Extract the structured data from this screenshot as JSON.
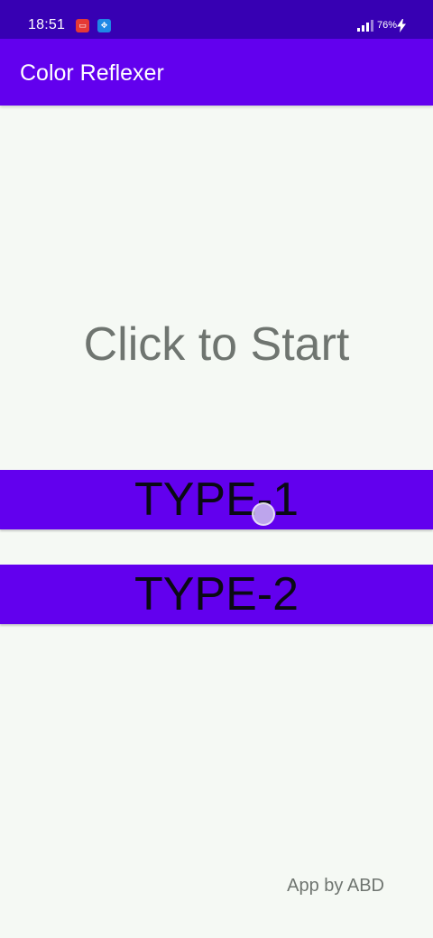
{
  "status_bar": {
    "time": "18:51",
    "battery": "76%",
    "notification_icons": [
      "screen-recorder-icon",
      "app-notification-icon"
    ]
  },
  "app_bar": {
    "title": "Color Reflexer"
  },
  "main": {
    "start_prompt": "Click to Start",
    "buttons": [
      {
        "label": "TYPE-1"
      },
      {
        "label": "TYPE-2"
      }
    ],
    "credit": "App by ABD"
  },
  "colors": {
    "status_bar": "#3700b3",
    "primary": "#6200ee",
    "background": "#f5f9f4",
    "muted_text": "#6f7570"
  }
}
